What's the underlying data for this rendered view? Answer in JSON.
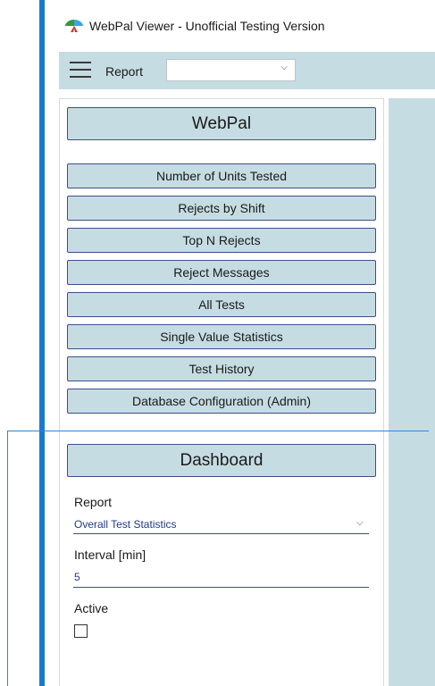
{
  "window": {
    "title": "WebPal Viewer - Unofficial Testing Version"
  },
  "toolbar": {
    "report_label": "Report",
    "report_select_value": ""
  },
  "panel": {
    "header": "WebPal",
    "nav_items": [
      "Number of Units Tested",
      "Rejects by Shift",
      "Top N Rejects",
      "Reject Messages",
      "All Tests",
      "Single Value Statistics",
      "Test History",
      "Database Configuration (Admin)"
    ]
  },
  "dashboard": {
    "header": "Dashboard",
    "report_label": "Report",
    "report_value": "Overall Test Statistics",
    "interval_label": "Interval [min]",
    "interval_value": "5",
    "active_label": "Active",
    "active_checked": false
  },
  "icons": {
    "app": "webpal-app-icon",
    "menu": "hamburger-menu-icon",
    "dropdown": "chevron-down-icon"
  },
  "colors": {
    "accent": "#1a78d2",
    "button_bg": "#c6dce3",
    "button_border": "#3f4d8c",
    "value_text": "#1f3a8a"
  }
}
